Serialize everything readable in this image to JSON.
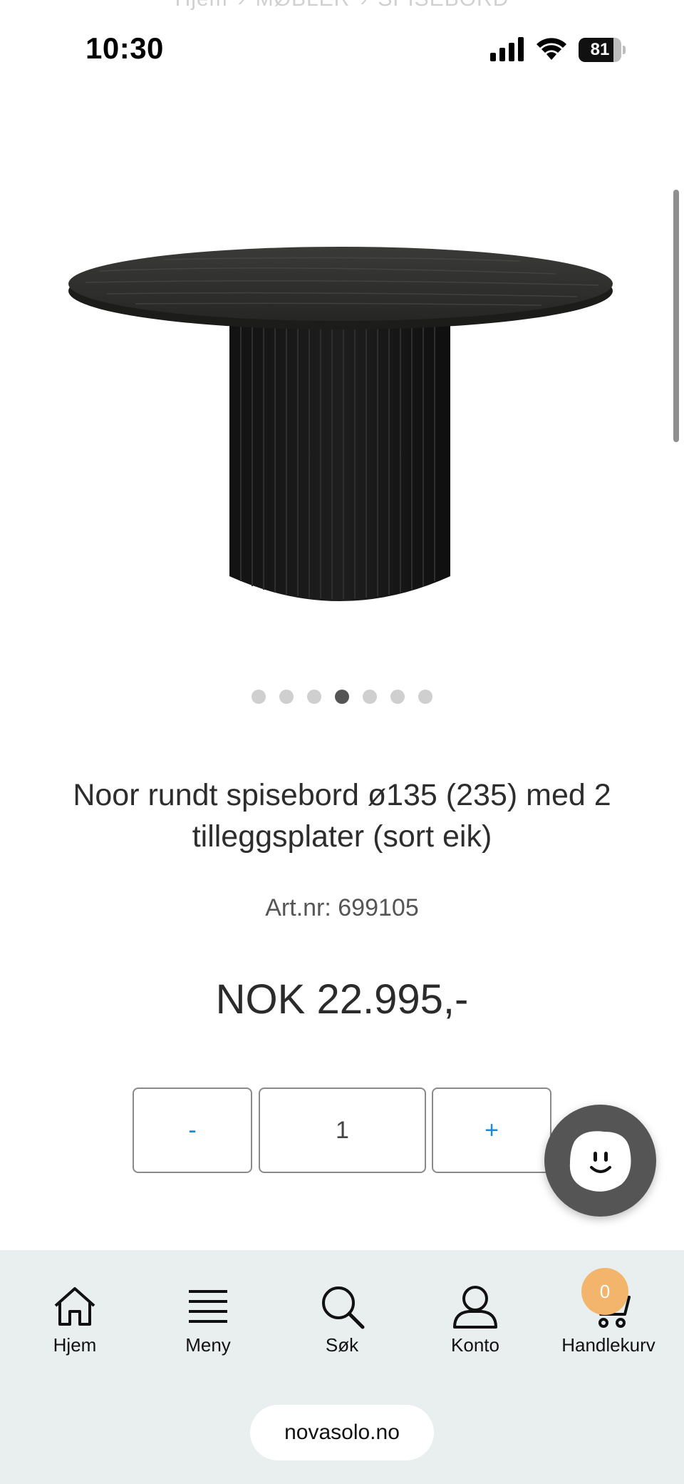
{
  "breadcrumb": [
    "Hjem",
    "MØBLER",
    "SPISEBORD"
  ],
  "status_bar": {
    "time": "10:30",
    "battery": "81",
    "battery_level": 0.81
  },
  "product": {
    "title": "Noor rundt spisebord ø135 (235) med 2 tilleggsplater (sort eik)",
    "art_nr": "Art.nr: 699105",
    "price": "NOK 22.995,-",
    "image_count": 7,
    "active_image": 4
  },
  "quantity": {
    "minus_label": "-",
    "value": "1",
    "plus_label": "+"
  },
  "bottom_nav": {
    "items": [
      {
        "label": "Hjem",
        "icon": "home-icon"
      },
      {
        "label": "Meny",
        "icon": "menu-icon"
      },
      {
        "label": "Søk",
        "icon": "search-icon"
      },
      {
        "label": "Konto",
        "icon": "account-icon"
      },
      {
        "label": "Handlekurv",
        "icon": "cart-icon"
      }
    ],
    "cart_count": "0"
  },
  "browser": {
    "url": "novasolo.no"
  },
  "colors": {
    "accent": "#1a8ad4",
    "badge": "#f2b56b",
    "chat": "#555555",
    "nav_bg": "#e9eeef"
  }
}
